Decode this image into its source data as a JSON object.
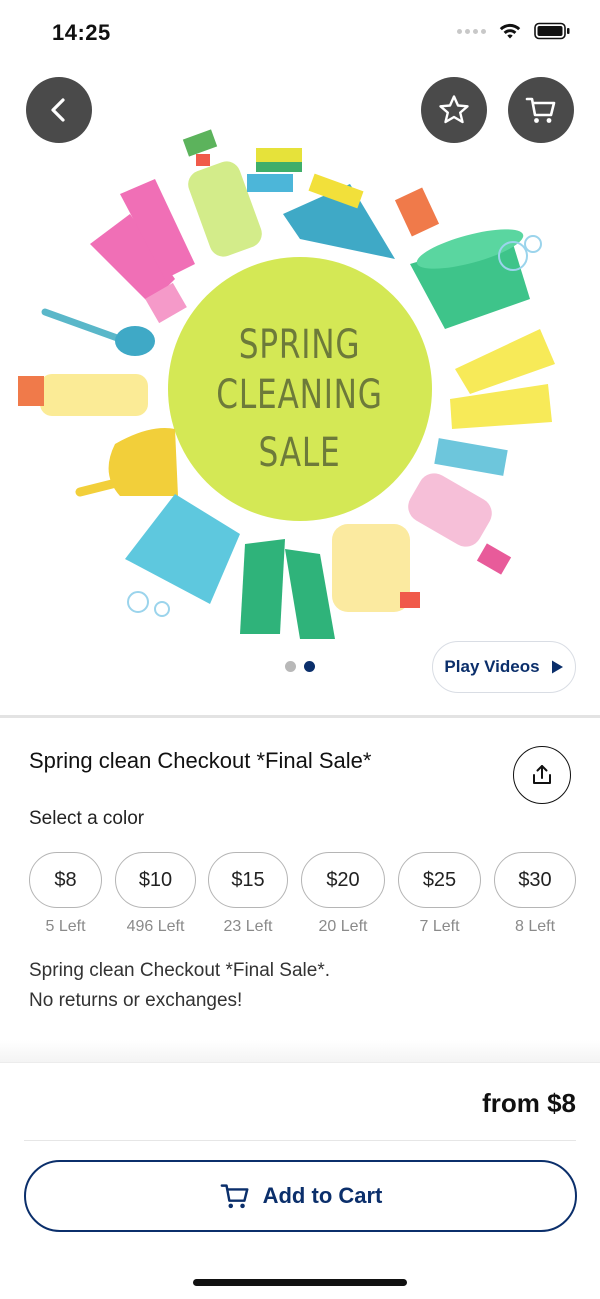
{
  "status_bar": {
    "time": "14:25"
  },
  "hero": {
    "banner_text_line1": "SPRING",
    "banner_text_line2": "CLEANING",
    "banner_text_line3": "SALE",
    "play_videos_label": "Play Videos",
    "carousel_total": 2,
    "carousel_active": 2
  },
  "product": {
    "title": "Spring clean Checkout *Final Sale*",
    "select_label": "Select a color",
    "options": [
      {
        "label": "$8",
        "stock": "5 Left"
      },
      {
        "label": "$10",
        "stock": "496 Left"
      },
      {
        "label": "$15",
        "stock": "23 Left"
      },
      {
        "label": "$20",
        "stock": "20 Left"
      },
      {
        "label": "$25",
        "stock": "7 Left"
      },
      {
        "label": "$30",
        "stock": "8 Left"
      }
    ],
    "description_line1": "Spring clean Checkout *Final Sale*.",
    "description_line2": "No returns or exchanges!"
  },
  "footer": {
    "price": "from $8",
    "add_to_cart_label": "Add to Cart"
  },
  "colors": {
    "brand_navy": "#0b2f6b",
    "overlay_button": "#4a4a4a",
    "banner_circle": "#d4e855"
  },
  "icons": [
    "back-arrow-icon",
    "star-icon",
    "cart-icon",
    "play-icon",
    "share-icon",
    "cart-icon"
  ]
}
